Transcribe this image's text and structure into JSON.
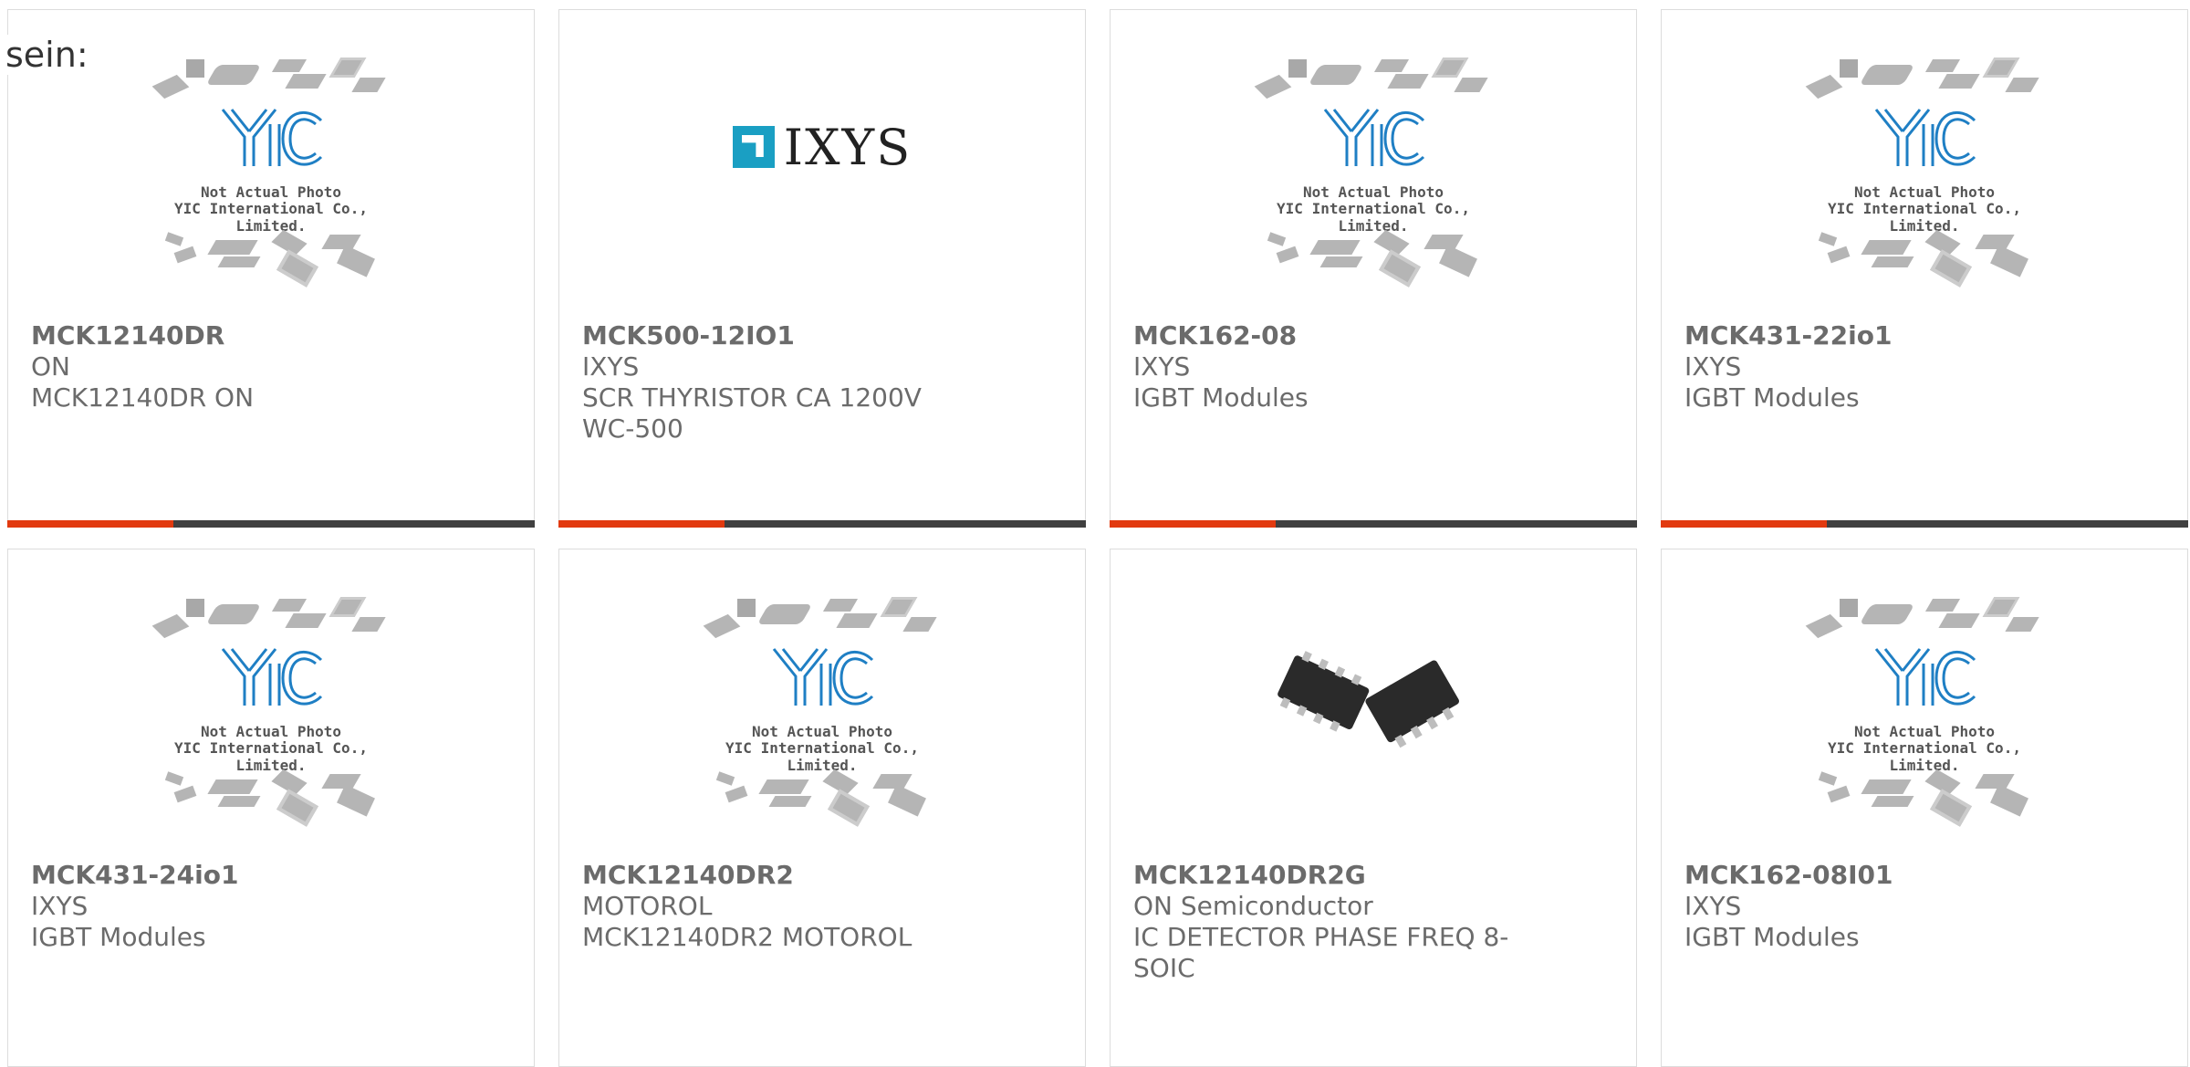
{
  "intro_text": "sein:",
  "placeholder": {
    "line1": "Not Actual Photo",
    "line2": "YIC International Co., Limited."
  },
  "colors": {
    "accent": "#e23a0f",
    "bar_dark": "#404040",
    "ixys_blue": "#1a9fc3",
    "yic_blue": "#1f7fc4"
  },
  "products": [
    {
      "part": "MCK12140DR",
      "brand": "ON",
      "description": "MCK12140DR ON",
      "image": "yic-placeholder"
    },
    {
      "part": "MCK500-12IO1",
      "brand": "IXYS",
      "description": "SCR THYRISTOR CA 1200V WC-500",
      "image": "ixys-logo",
      "logo_text": "IXYS"
    },
    {
      "part": "MCK162-08",
      "brand": "IXYS",
      "description": "IGBT Modules",
      "image": "yic-placeholder"
    },
    {
      "part": "MCK431-22io1",
      "brand": "IXYS",
      "description": "IGBT Modules",
      "image": "yic-placeholder"
    },
    {
      "part": "MCK431-24io1",
      "brand": "IXYS",
      "description": "IGBT Modules",
      "image": "yic-placeholder"
    },
    {
      "part": "MCK12140DR2",
      "brand": "MOTOROL",
      "description": "MCK12140DR2 MOTOROL",
      "image": "yic-placeholder"
    },
    {
      "part": "MCK12140DR2G",
      "brand": "ON Semiconductor",
      "description": "IC DETECTOR PHASE FREQ 8-SOIC",
      "image": "soic-chip-photo"
    },
    {
      "part": "MCK162-08I01",
      "brand": "IXYS",
      "description": "IGBT Modules",
      "image": "yic-placeholder"
    }
  ]
}
